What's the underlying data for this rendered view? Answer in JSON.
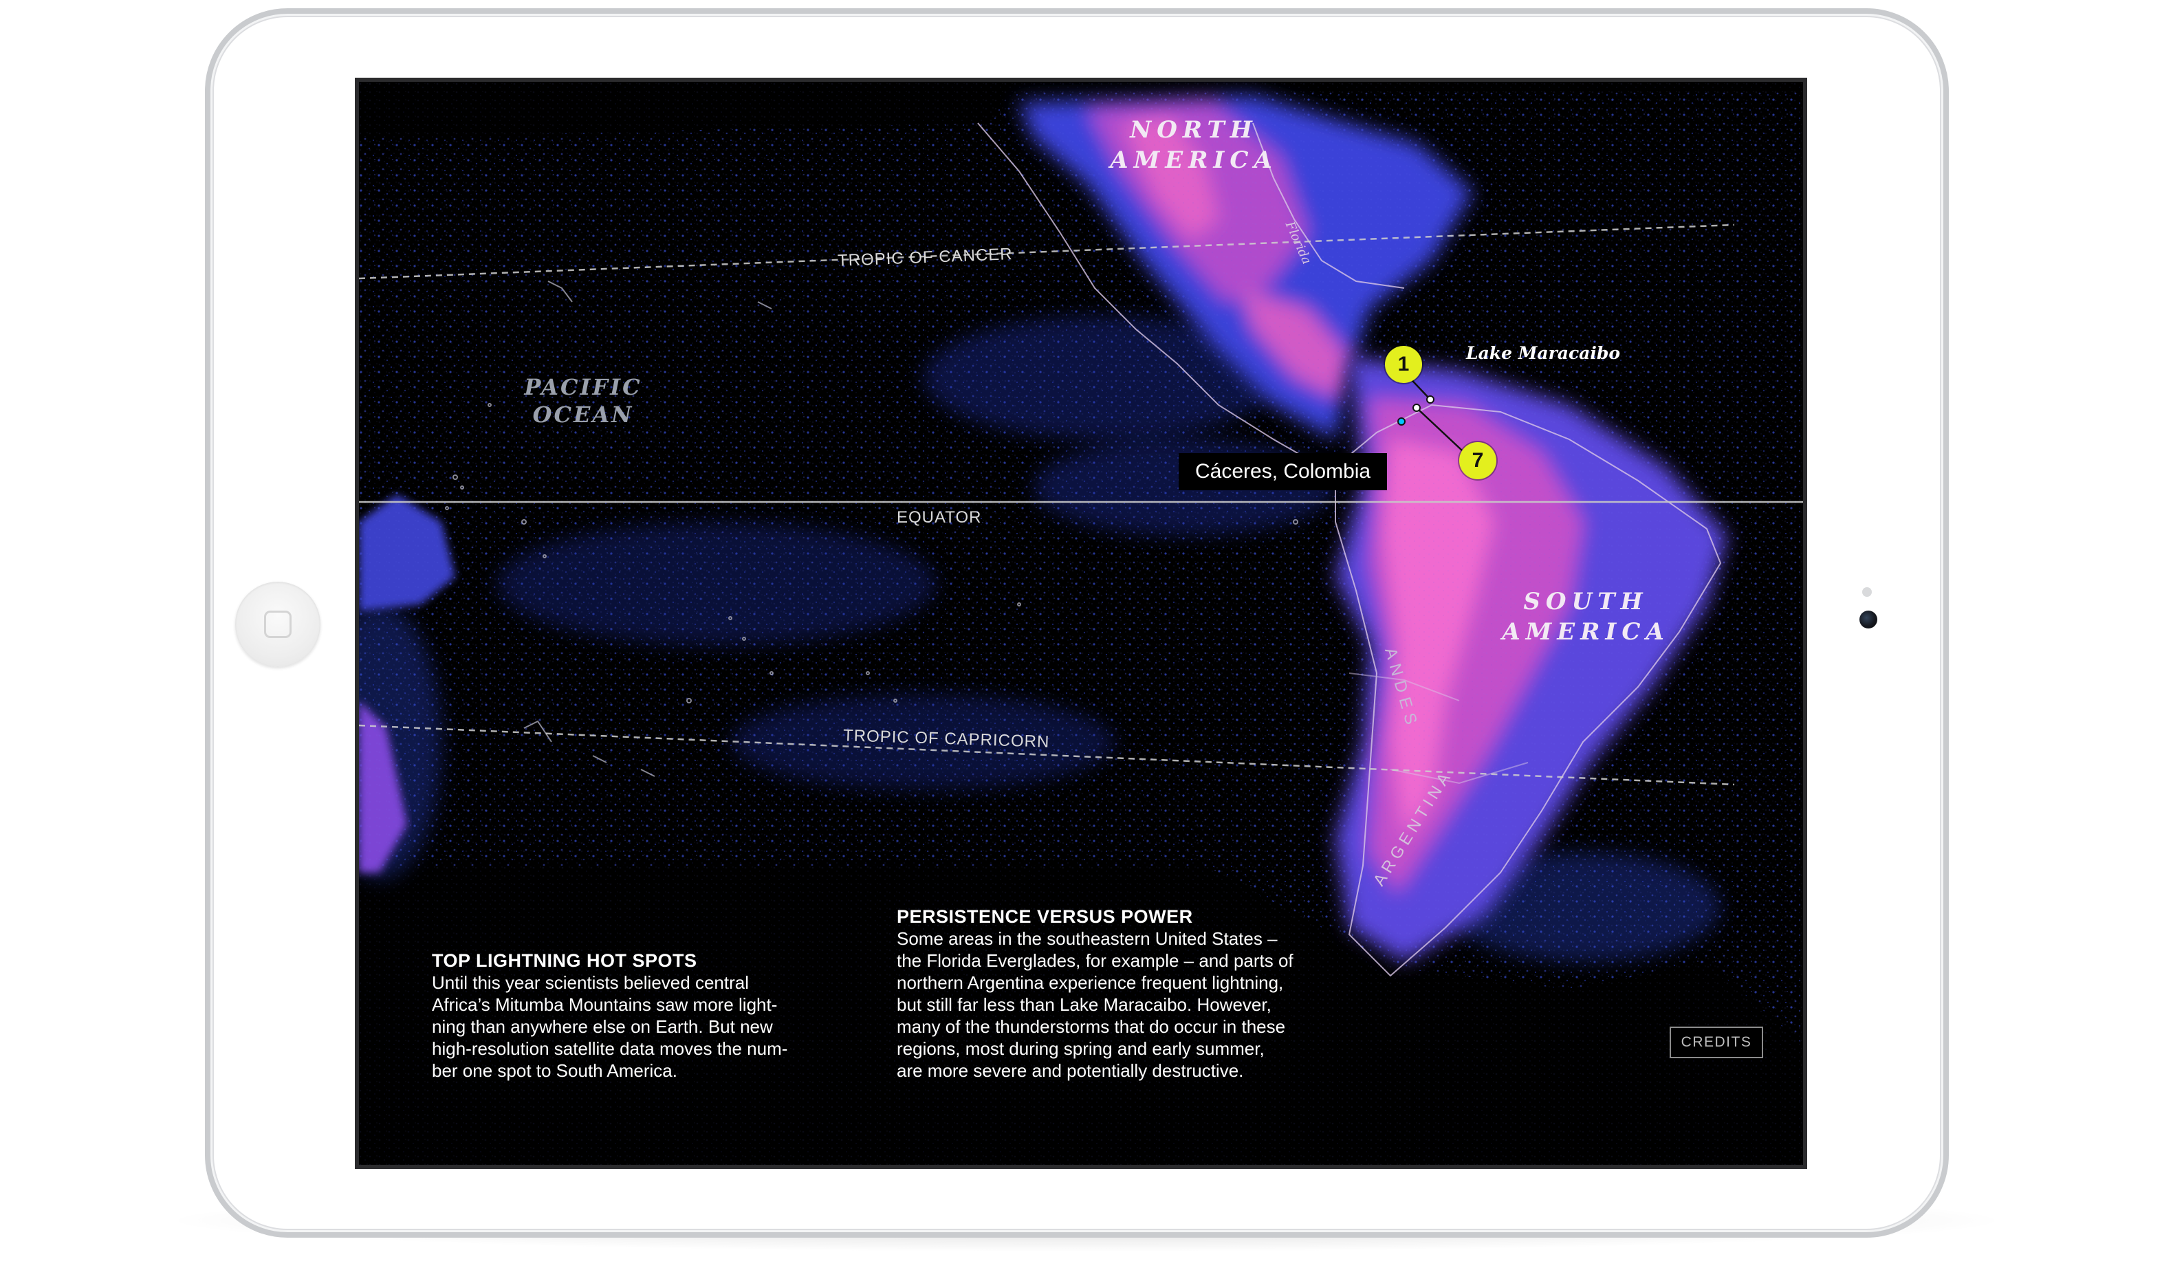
{
  "map": {
    "continents": [
      "NORTH AMERICA",
      "SOUTH AMERICA"
    ],
    "north_america_lines": [
      "NORTH",
      "AMERICA"
    ],
    "south_america_lines": [
      "SOUTH",
      "AMERICA"
    ],
    "ocean_lines": [
      "PACIFIC",
      "OCEAN"
    ],
    "tropic_of_cancer": "TROPIC OF CANCER",
    "equator": "EQUATOR",
    "tropic_of_capricorn": "TROPIC OF CAPRICORN",
    "lake_label": "Lake Maracaibo",
    "caceres_label": "Cáceres, Colombia",
    "marker_1": "1",
    "marker_7": "7",
    "andes": "ANDES",
    "argentina": "ARGENTINA",
    "florida": "Florida",
    "colors": {
      "background": "#000000",
      "low_density": "#2a44d0",
      "mid_density": "#6a3ed8",
      "high_density": "#d24ec0",
      "marker": "#e3ef1e"
    }
  },
  "hot_spots": {
    "heading": "TOP LIGHTNING HOT SPOTS",
    "lines": [
      "Until this year scientists believed central",
      "Africa’s Mitumba Mountains saw more light-",
      "ning than anywhere else on Earth. But new",
      "high-resolution satellite data moves the num-",
      "ber one spot to South America."
    ]
  },
  "persistence": {
    "heading": "PERSISTENCE VERSUS POWER",
    "lines": [
      "Some areas in the southeastern United States –",
      "the Florida Everglades, for example – and parts of",
      "northern Argentina experience frequent lightning,",
      "but still far less than Lake Maracaibo. However,",
      "many of the thunderstorms that do occur in these",
      "regions, most during spring and early summer,",
      "are more severe and potentially destructive."
    ]
  },
  "credits_label": "CREDITS"
}
